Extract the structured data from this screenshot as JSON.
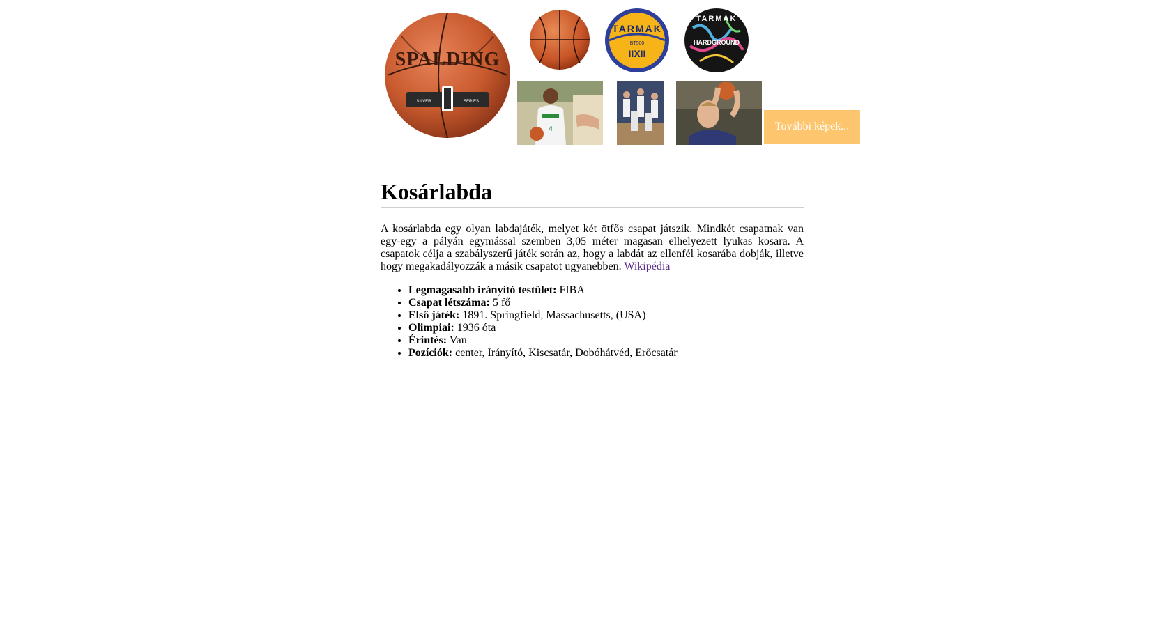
{
  "gallery": {
    "more_button": "További képek..."
  },
  "article": {
    "title": "Kosárlabda",
    "description": "A kosárlabda egy olyan labdajáték, melyet két ötfős csapat játszik. Mindkét csapatnak van egy-egy a pályán egymással szemben 3,05 méter magasan elhelyezett lyukas kosara. A csapatok célja a szabályszerű játék során az, hogy a labdát az ellenfél kosarába dobják, illetve hogy megakadályozzák a másik csapatot ugyanebben.",
    "source_link": "Wikipédia",
    "link_color": "#5a2d8c",
    "facts": [
      {
        "label": "Legmagasabb irányító testület:",
        "value": "FIBA"
      },
      {
        "label": "Csapat létszáma:",
        "value": "5 fő"
      },
      {
        "label": "Első játék:",
        "value": "1891. Springfield, Massachusetts, (USA)"
      },
      {
        "label": "Olimpiai:",
        "value": "1936 óta"
      },
      {
        "label": "Érintés:",
        "value": "Van"
      },
      {
        "label": "Pozíciók:",
        "value": "center, Irányító, Kiscsatár, Dobóhátvéd, Erőcsatár"
      }
    ]
  },
  "logos": {
    "ball1_text": "SPALDING",
    "ball1_sub": "SILVER SERIES",
    "ball3_text": "TARMAK",
    "ball3_sub": "BT500",
    "ball4_text": "TARMAK",
    "ball4_sub": "HARDGROUND"
  },
  "colors": {
    "button_bg": "#fdc56d",
    "button_text": "#ffffff"
  }
}
